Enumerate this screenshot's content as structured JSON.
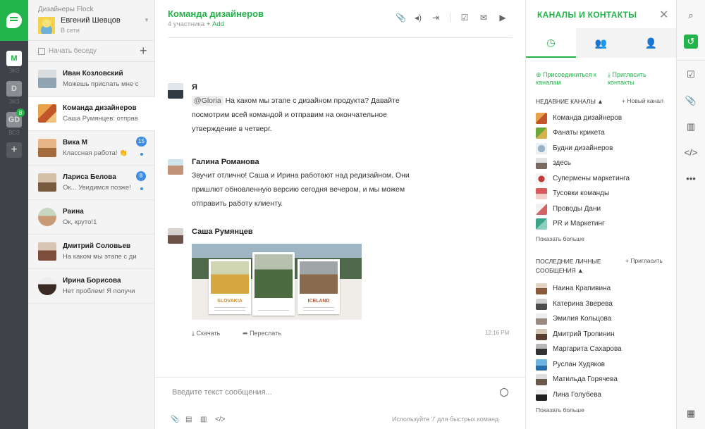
{
  "teams": [
    {
      "initial": "M",
      "label": "ЭКЗ",
      "active": true
    },
    {
      "initial": "D",
      "label": "ЭКЗ",
      "active": false
    },
    {
      "initial": "GD",
      "label": "ВСЗ",
      "active": false,
      "badge": "8"
    }
  ],
  "me": {
    "team_name": "Дизайнеры Flock",
    "name": "Евгений Шевцов",
    "status": "В сети"
  },
  "start_chat": {
    "label": "Начать беседу"
  },
  "conversations": [
    {
      "title": "Иван Козловский",
      "preview": "Можешь прислать мне с"
    },
    {
      "title": "Команда дизайнеров",
      "preview": "Саша Румянцев: отправ"
    },
    {
      "title": "Вика М",
      "preview": "Классная работа! 👏",
      "badge": "15"
    },
    {
      "title": "Лариса Белова",
      "preview": "Ок... Увидимся позже!",
      "badge": "8"
    },
    {
      "title": "Раина",
      "preview": "Ок, круто!1"
    },
    {
      "title": "Дмитрий Соловьев",
      "preview": "На каком мы этапе с ди"
    },
    {
      "title": "Ирина Борисова",
      "preview": "Нет проблем! Я получи"
    }
  ],
  "channel": {
    "title": "Команда дизайнеров",
    "members": "4 участника",
    "add": "+ Add"
  },
  "header_icons": [
    "paperclip-icon",
    "speaker-icon",
    "exit-icon",
    "checkbox-icon",
    "mail-icon",
    "video-icon"
  ],
  "messages": [
    {
      "author": "Я",
      "mention": "@Gloria",
      "text": " На каком мы этапе с дизайном продукта? Давайте посмотрим всей командой и отправим на окончательное утверждение в четверг."
    },
    {
      "author": "Галина Романова",
      "text": "Звучит отлично! Саша и Ирина работают над редизайном. Они пришлют обновленную версию сегодня вечером, и мы можем отправить работу клиенту."
    },
    {
      "author": "Саша Румянцев"
    }
  ],
  "attachment": {
    "cards": [
      "SLOVAKIA",
      "",
      "ICELAND"
    ],
    "download": "Скачать",
    "forward": "Переслать",
    "time": "12:16 PM"
  },
  "composer": {
    "placeholder": "Введите текст сообщения...",
    "hint": "Используйте '/' для быстрых команд"
  },
  "panel": {
    "title": "КАНАЛЫ И КОНТАКТЫ",
    "join": "Присоединиться к каналам",
    "invite": "Пригласить контакты",
    "recent_channels_title": "НЕДАВНИЕ КАНАЛЫ",
    "new_channel": "Новый канал",
    "channels": [
      "Команда дизайнеров",
      "Фанаты крикета",
      "Будни дизайнеров",
      "здесь",
      "Супермены маркетинга",
      "Тусовки команды",
      "Проводы Дани",
      "PR и Маркетинг"
    ],
    "show_more": "Показать больше",
    "recent_contacts_title": "ПОСЛЕДНИЕ ЛИЧНЫЕ СООБЩЕНИЯ",
    "invite_contacts": "Пригласить",
    "contacts": [
      "Наина Крапивина",
      "Катерина Зверева",
      "Эмилия Кольцова",
      "Дмитрий Тропинин",
      "Маргарита Сахарова",
      "Руслан Худяков",
      "Матильда Горячева",
      "Лина Голубева"
    ],
    "show_more_contacts": "Показать больше"
  },
  "colors": {
    "accent": "#22b34a",
    "badge": "#3d8ee3",
    "rail": "#3f4349"
  }
}
